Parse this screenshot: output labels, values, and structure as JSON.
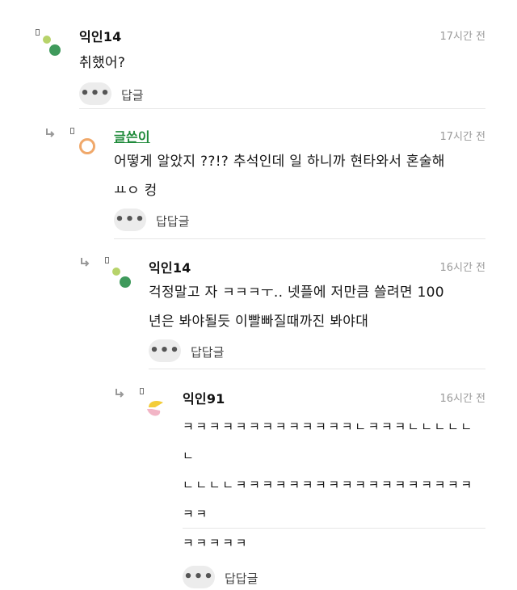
{
  "comments": [
    {
      "nick": "익인14",
      "time": "17시간 전",
      "lines": [
        "취했어?"
      ],
      "reply_label": "답글"
    },
    {
      "nick": "글쓴이",
      "time": "17시간 전",
      "lines": [
        "어떻게 알았지 ??!? 추석인데 일 하니까 현타와서 혼술해",
        "ㅛㅇ 컹"
      ],
      "reply_label": "답답글"
    },
    {
      "nick": "익인14",
      "time": "16시간 전",
      "lines": [
        "걱정말고 자 ㅋㅋㅋㅜ.. 넷플에 저만큼 쓸려면 100",
        "년은 봐야될듯 이빨빠질때까진 봐야대"
      ],
      "reply_label": "답답글"
    },
    {
      "nick": "익인91",
      "time": "16시간 전",
      "lines": [
        "ㅋㅋㅋㅋㅋㅋㅋㅋㅋㅋㅋㅋㅋㄴㅋㅋㅋㄴㄴㄴㄴㄴㄴ",
        "ㄴㄴㄴㄴㅋㅋㅋㅋㅋㅋㅋㅋㅋㅋㅋㅋㅋㅋㅋㅋㅋㅋㅋㅋ",
        "ㅋㅋㅋㅋㅋ"
      ],
      "reply_label": "답답글"
    }
  ],
  "more_icon": "ellipsis-icon",
  "colors": {
    "writer_nick": "#1f8a3a",
    "time": "#9a9a9a",
    "divider": "#e6e6e6",
    "more_bg": "#ececec"
  }
}
